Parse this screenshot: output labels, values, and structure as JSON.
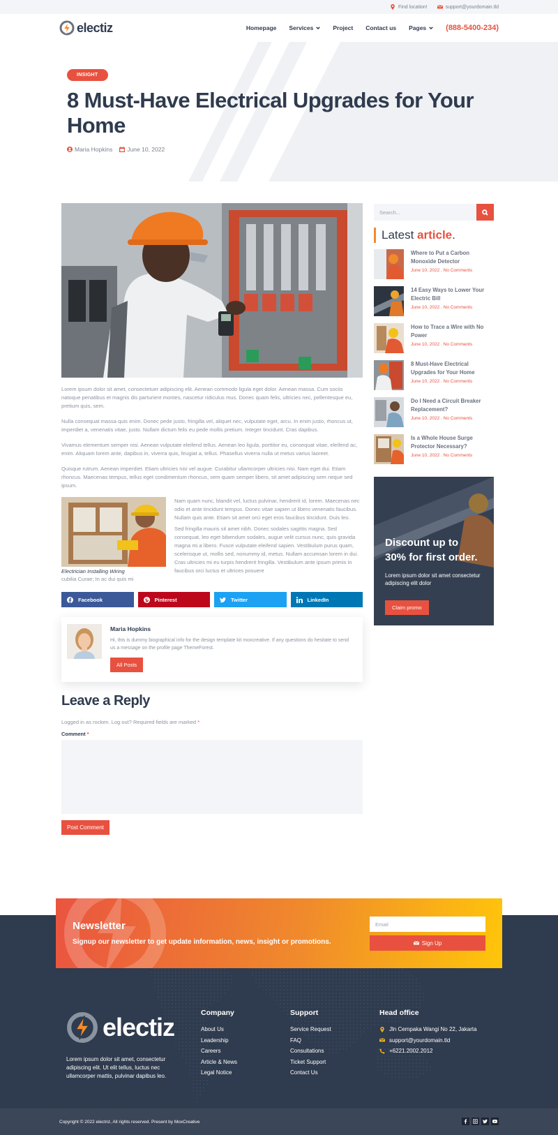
{
  "topbar": {
    "location": "Find location!",
    "email": "support@yourdomain.tld"
  },
  "header": {
    "logo_text": "electiz",
    "nav": [
      "Homepage",
      "Services",
      "Project",
      "Contact us",
      "Pages"
    ],
    "phone": "(888-5400-234)"
  },
  "hero": {
    "badge": "INSIGHT",
    "title": "8 Must-Have Electrical Upgrades for Your Home",
    "author": "Maria Hopkins",
    "date": "June 10, 2022"
  },
  "article": {
    "paragraphs": [
      "Lorem ipsum dolor sit amet, consectetuer adipiscing elit. Aenean commodo ligula eget dolor. Aenean massa. Cum sociis natoque penatibus et magnis dis parturient montes, nascetur ridiculus mus. Donec quam felis, ultricies nec, pellentesque eu, pretium quis, sem.",
      "Nulla consequat massa quis enim. Donec pede justo, fringilla vel, aliquet nec, vulputate eget, arcu. In enim justo, rhoncus ut, imperdiet a, venenatis vitae, justo. Nullam dictum felis eu pede mollis pretium. Integer tincidunt. Cras dapibus.",
      "Vivamus elementum semper nisi. Aenean vulputate eleifend tellus. Aenean leo ligula, porttitor eu, consequat vitae, eleifend ac, enim. Aliquam lorem ante, dapibus in, viverra quis, feugiat a, tellus. Phasellus viverra nulla ut metus varius laoreet.",
      "Quisque rutrum. Aenean imperdiet. Etiam ultricies nisi vel augue. Curabitur ullamcorper ultricies nisi. Nam eget dui. Etiam rhoncus. Maecenas tempus, tellus eget condimentum rhoncus, sem quam semper libero, sit amet adipiscing sem neque sed ipsum."
    ],
    "figure_caption": "Electrician Installing Wiring",
    "figure_text_1": "Nam quam nunc, blandit vel, luctus pulvinar, hendrerit id, lorem. Maecenas nec odio et ante tincidunt tempus. Donec vitae sapien ut libero venenatis faucibus. Nullam quis ante. Etiam sit amet orci eget eros faucibus tincidunt. Duis leo.",
    "figure_text_2": "Sed fringilla mauris sit amet nibh. Donec sodales sagittis magna. Sed consequat, leo eget bibendum sodales, augue velit cursus nunc, quis gravida magna mi a libero. Fusce vulputate eleifend sapien. Vestibulum purus quam, scelerisque ut, mollis sed, nonummy id, metus. Nullam accumsan lorem in dui. Cras ultricies mi eu turpis hendrerit fringilla. Vestibulum ante ipsum primis in faucibus orci luctus et ultrices posuere",
    "tail_text": "cubilia Curae; In ac dui quis mi"
  },
  "share": [
    {
      "label": "Facebook",
      "color": "#3b5998",
      "icon": "facebook-icon"
    },
    {
      "label": "Pinterest",
      "color": "#bd081c",
      "icon": "pinterest-icon"
    },
    {
      "label": "Twitter",
      "color": "#1da1f2",
      "icon": "twitter-icon"
    },
    {
      "label": "LinkedIn",
      "color": "#0077b5",
      "icon": "linkedin-icon"
    }
  ],
  "author_box": {
    "name": "Maria Hopkins",
    "bio": "Hi, this is dummy biographical info for the design template kit moxcreative. If any questions do hesitate to send us a message on the profile page ThemeForest.",
    "button": "All Posts"
  },
  "reply": {
    "title": "Leave a Reply",
    "logged_prefix": "Logged in as rocken. Log out? Required fields are marked ",
    "required_mark": "*",
    "comment_label": "Comment ",
    "submit": "Post Comment"
  },
  "sidebar": {
    "search_placeholder": "Search...",
    "latest_prefix": "Latest ",
    "latest_accent": "article",
    "latest_dot": ".",
    "posts": [
      {
        "title": "Where to Put a Carbon Monoxide Detector",
        "meta": "June 10, 2022 . No Comments"
      },
      {
        "title": "14 Easy Ways to Lower Your Electric Bill",
        "meta": "June 10, 2022 . No Comments"
      },
      {
        "title": "How to Trace a Wire with No Power",
        "meta": "June 10, 2022 . No Comments"
      },
      {
        "title": "8 Must-Have Electrical Upgrades for Your Home",
        "meta": "June 10, 2022 . No Comments"
      },
      {
        "title": "Do I Need a Circuit Breaker Replacement?",
        "meta": "June 10, 2022 . No Comments"
      },
      {
        "title": "Is a Whole House Surge Protector Necessary?",
        "meta": "June 10, 2022 . No Comments"
      }
    ],
    "promo": {
      "title_1": "Discount up to",
      "title_2": "30% for first order.",
      "desc": "Lorem ipsum dolor sit amet consectetur adipiscing elit dolor",
      "button": "Claim promo"
    }
  },
  "newsletter": {
    "title": "Newsletter",
    "subtitle": "Signup our newsletter to get update information, news, insight or promotions.",
    "email_placeholder": "Email",
    "button": "Sign Up"
  },
  "footer": {
    "logo_text": "electiz",
    "about": "Lorem ipsum dolor sit amet, consectetur adipiscing elit. Ut elit tellus, luctus nec ullamcorper mattis, pulvinar dapibus leo.",
    "company_title": "Company",
    "company_links": [
      "About Us",
      "Leadership",
      "Careers",
      "Article & News",
      "Legal Notice"
    ],
    "support_title": "Support",
    "support_links": [
      "Service Request",
      "FAQ",
      "Consultations",
      "Ticket Support",
      "Contact Us"
    ],
    "office_title": "Head office",
    "office": [
      "Jln Cempaka Wangi No 22, Jakarta",
      "support@yourdomain.tld",
      "+6221.2002.2012"
    ],
    "copyright": "Copyright © 2022 electriz, All rights reserved. Present by MoxCreative"
  },
  "colors": {
    "accent": "#e8513f",
    "dark": "#2f3b4e",
    "gold": "#f5b013"
  }
}
